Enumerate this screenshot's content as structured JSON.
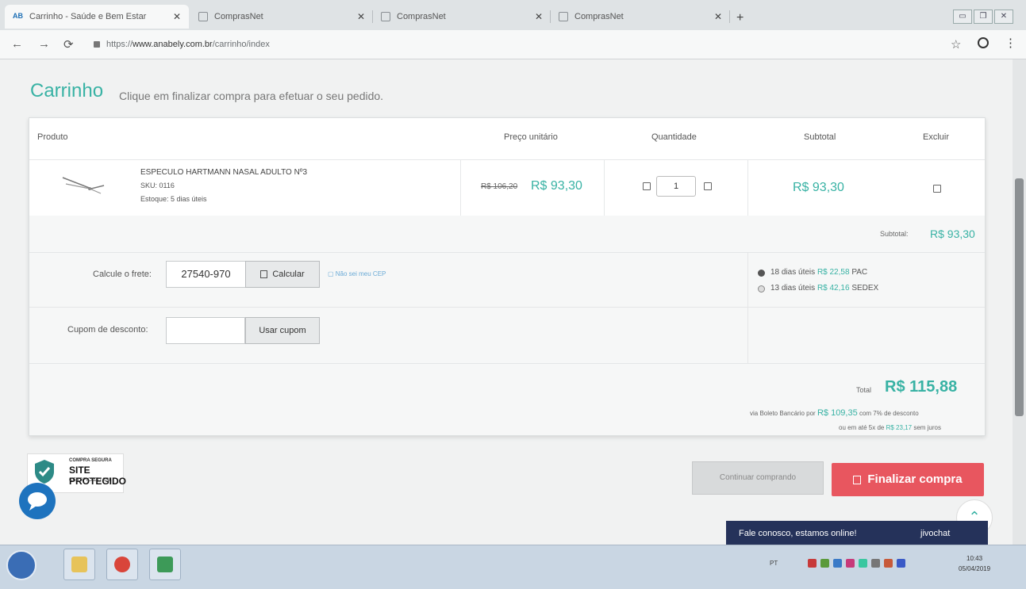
{
  "browser": {
    "tabs": [
      {
        "title": "Carrinho - Saúde e Bem Estar",
        "icon": "site-logo",
        "logo_text": "AB"
      },
      {
        "title": "ComprasNet",
        "icon": "page-icon"
      },
      {
        "title": "ComprasNet",
        "icon": "page-icon"
      },
      {
        "title": "ComprasNet",
        "icon": "page-icon"
      }
    ],
    "url_prefix": "https://",
    "url_domain": "www.anabely.com.br",
    "url_path": "/carrinho/index"
  },
  "page": {
    "title": "Carrinho",
    "subtitle": "Clique em finalizar compra para efetuar o seu pedido.",
    "table_headers": {
      "product": "Produto",
      "unit_price": "Preço unitário",
      "quantity": "Quantidade",
      "subtotal": "Subtotal",
      "remove": "Excluir"
    },
    "item": {
      "name": "ESPECULO HARTMANN NASAL ADULTO Nº3",
      "sku": "SKU: 0116",
      "stock": "Estoque: 5 dias úteis",
      "old_price": "R$ 106,20",
      "price": "R$ 93,30",
      "quantity": "1",
      "subtotal": "R$ 93,30"
    },
    "subtotal_label": "Subtotal:",
    "subtotal_value": "R$ 93,30",
    "shipping": {
      "label": "Calcule o frete:",
      "cep_value": "27540-970",
      "calc_button": "Calcular",
      "no_cep_link": "Não sei meu CEP",
      "options": [
        {
          "days": "18 dias úteis",
          "price": "R$ 22,58",
          "method": "PAC",
          "selected": true
        },
        {
          "days": "13 dias úteis",
          "price": "R$ 42,16",
          "method": "SEDEX",
          "selected": false
        }
      ]
    },
    "coupon": {
      "label": "Cupom de desconto:",
      "value": "",
      "button": "Usar cupom"
    },
    "total_label": "Total",
    "total_value": "R$ 115,88",
    "boleto_prefix": "via Boleto Bancário por",
    "boleto_value": "R$ 109,35",
    "boleto_suffix": "com 7% de desconto",
    "install_prefix": "ou em até 5x de",
    "install_value": "R$ 23,17",
    "install_suffix": "sem juros",
    "continue_button": "Continuar comprando",
    "finish_button": "Finalizar compra",
    "badge": {
      "top": "COMPRA SEGURA",
      "main": "SITE PROTEGIDO",
      "bottom": "CERTIFICADO SSL"
    },
    "chat": {
      "text": "Fale conosco, estamos online!",
      "brand": "jivochat"
    }
  },
  "taskbar": {
    "lang": "PT",
    "time": "10:43",
    "date": "05/04/2019"
  },
  "colors": {
    "accent": "#38b2a4",
    "finish": "#e8565f",
    "chat": "#25325a"
  }
}
